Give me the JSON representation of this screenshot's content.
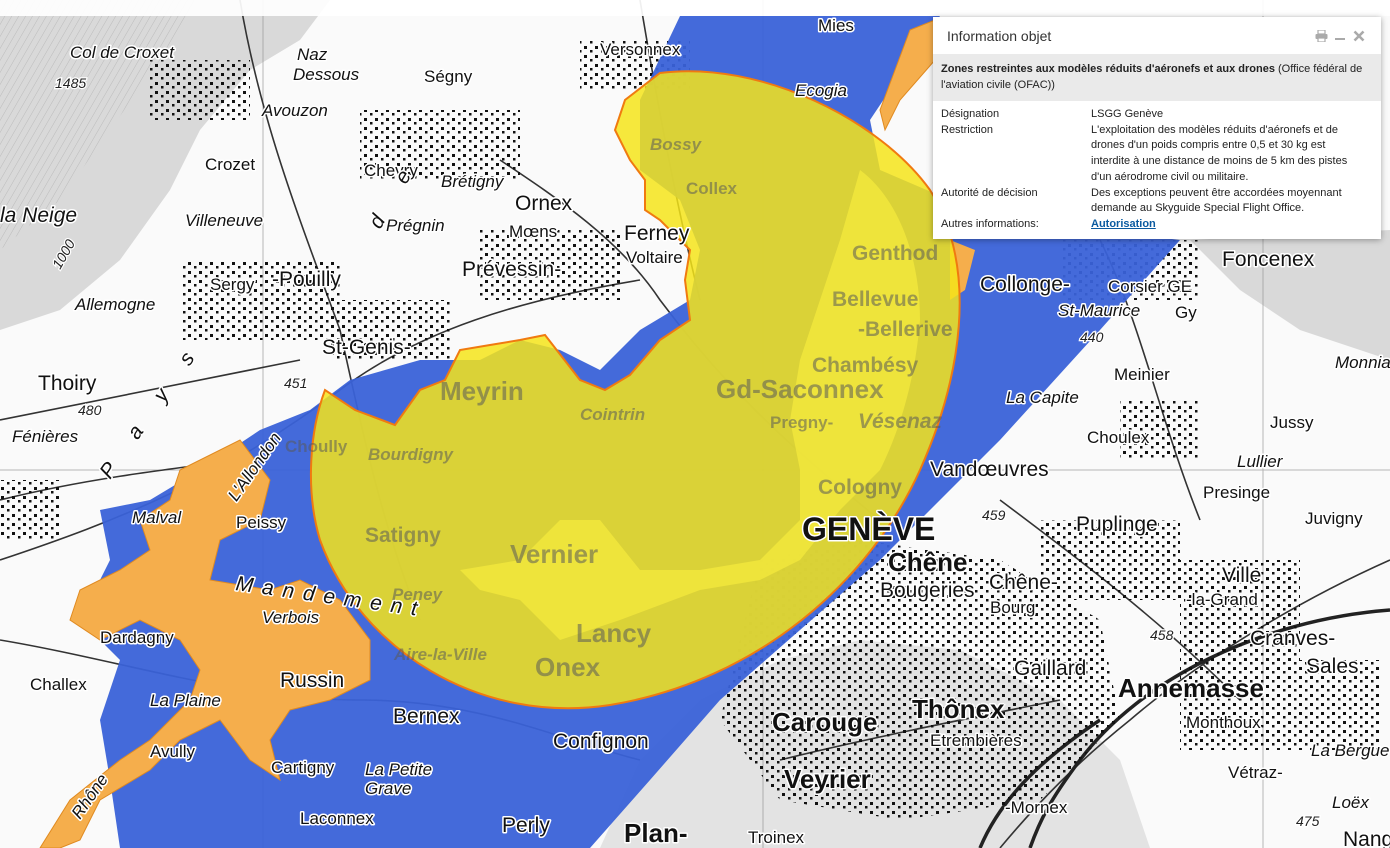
{
  "panel": {
    "title": "Information objet",
    "layer_name": "Zones restreintes aux modèles réduits d'aéronefs et aux drones",
    "layer_source": " (Office fédéral de l'aviation civile (OFAC))",
    "rows": [
      {
        "key": "Désignation",
        "value": "LSGG Genève"
      },
      {
        "key": "Restriction",
        "value": "L'exploitation des modèles réduits d'aéronefs et de drones d'un poids compris entre 0,5 et 30 kg est interdite à une distance de moins de 5 km des pistes d'un aérodrome civil ou militaire."
      },
      {
        "key": "Autorité de décision",
        "value": "Des exceptions peuvent être accordées moyennant demande au Skyguide Special Flight Office."
      },
      {
        "key": "Autres informations:",
        "link": "Autorisation"
      }
    ],
    "icons": [
      "print-icon",
      "minimize-icon",
      "close-icon"
    ]
  },
  "map": {
    "colors": {
      "restricted_zone": "#f5e41a",
      "blue_zone": "#3a62d8",
      "orange_zone": "#f5ae4c",
      "zone_outline": "#f07a10"
    },
    "labels": {
      "col_croxet": "Col de Croxet",
      "p1485": "1485",
      "naz": "Naz",
      "dessous": "Dessous",
      "segny": "Ségny",
      "versonnex": "Versonnex",
      "mies": "Mies",
      "avouzon": "Avouzon",
      "chevry": "Chevry",
      "bretigny": "Brétigny",
      "ornex": "Ornex",
      "ecogia": "Ecogia",
      "bossy": "Bossy",
      "collex": "Collex",
      "crozet": "Crozet",
      "la_neige": "la Neige",
      "villeneuve": "Villeneuve",
      "pregnin": "Prégnin",
      "moens": "Mœns",
      "ferney": "Ferney",
      "voltaire": "Voltaire",
      "genthod": "Genthod",
      "sergy": "Sergy",
      "pouilly": "-Pouilly",
      "prevessin": "Prévessin-",
      "foncenex": "Foncenex",
      "allemogne": "Allemogne",
      "collonge": "Collonge-",
      "corsier": "Corsier GE",
      "gy": "Gy",
      "bellevue": "Bellevue",
      "bellerive": "-Bellerive",
      "st_maurice": "St-Maurice",
      "st_genis": "St-Genis-",
      "p451": "451",
      "p440": "440",
      "thoiry": "Thoiry",
      "p480": "480",
      "meyrin": "Meyrin",
      "gd_saconnex": "Gd-Saconnex",
      "chambesy": "Chambésy",
      "meinier": "Meinier",
      "monniaz": "Monniaz",
      "pregny": "Pregny-",
      "vesenaz": "Vésenaz",
      "la_capite": "La Capite",
      "fenieres": "Fénières",
      "jussy": "Jussy",
      "choulex": "Choulex",
      "vandoeuvres": "Vandœuvres",
      "lullier": "Lullier",
      "cologny": "Cologny",
      "presinge": "Presinge",
      "p459": "459",
      "peissy": "Peissy",
      "malval": "Malval",
      "satigny": "Satigny",
      "vernier": "Vernier",
      "geneve": "GENÈVE",
      "puplinge": "Puplinge",
      "juvigny": "Juvigny",
      "chene": "Chêne",
      "bougeries": "Bougeries",
      "chene2": "Chêne-",
      "bourg": "Bourg",
      "ville": "Ville",
      "la_grand": "-la-Grand",
      "mandement": "Mandement",
      "dardagny": "Dardagny",
      "verbois": "Verbois",
      "lancy": "Lancy",
      "onex": "Onex",
      "gaillard": "Gaillard",
      "p458": "458",
      "cranves": "Cranves-",
      "sales": "Sales",
      "challex": "Challex",
      "russin": "Russin",
      "la_plaine": "La Plaine",
      "bernex": "Bernex",
      "annemasse": "Annemasse",
      "carouge": "Carouge",
      "thonex": "Thônex",
      "monthoux": "Monthoux",
      "etrembieres": "Etrembières",
      "confignon": "Confignon",
      "la_bergue": "La Bergue",
      "avully": "Avully",
      "cartigny": "Cartigny",
      "veyrier": "Veyrier",
      "vetraz": "Vétraz-",
      "la_petite": "La Petite",
      "grave": "Grave",
      "mornex": "-Mornex",
      "loex": "Loëx",
      "laconnex": "Laconnex",
      "perly": "Perly",
      "plan": "Plan-",
      "troinex": "Troinex",
      "p475": "475",
      "nang": "Nang",
      "rhone": "Rhône",
      "p1000": "1000",
      "pays": "Pays",
      "de": "de",
      "bourdigny": "Bourdigny",
      "cointrin": "Cointrin",
      "aire": "Aire-la-Ville",
      "peney": "Peney",
      "allondon": "L'Allondon",
      "choully": "Choully"
    }
  }
}
